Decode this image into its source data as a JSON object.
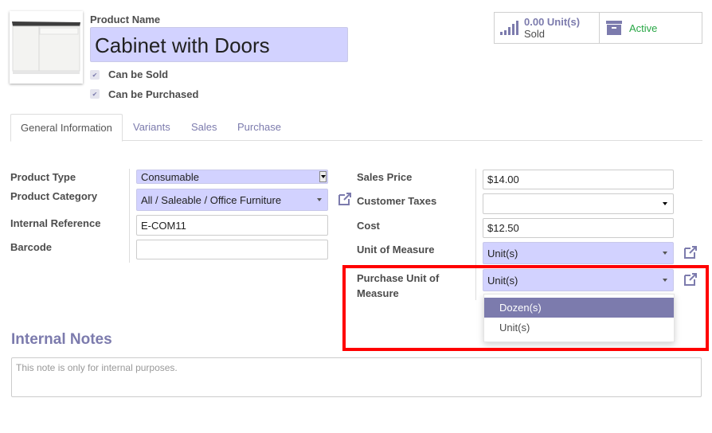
{
  "product": {
    "name_label": "Product Name",
    "name": "Cabinet with Doors",
    "can_be_sold_label": "Can be Sold",
    "can_be_sold": true,
    "can_be_purchased_label": "Can be Purchased",
    "can_be_purchased": true
  },
  "stat_buttons": {
    "sold_value": "0.00 Unit(s)",
    "sold_label": "Sold",
    "active_label": "Active",
    "active_color": "#28a745"
  },
  "tabs": [
    {
      "label": "General Information",
      "active": true
    },
    {
      "label": "Variants",
      "active": false
    },
    {
      "label": "Sales",
      "active": false
    },
    {
      "label": "Purchase",
      "active": false
    }
  ],
  "left_fields": {
    "product_type": {
      "label": "Product Type",
      "value": "Consumable"
    },
    "product_category": {
      "label": "Product Category",
      "value": "All / Saleable / Office Furniture"
    },
    "internal_reference": {
      "label": "Internal Reference",
      "value": "E-COM11"
    },
    "barcode": {
      "label": "Barcode",
      "value": ""
    }
  },
  "right_fields": {
    "sales_price": {
      "label": "Sales Price",
      "value": "$14.00"
    },
    "customer_taxes": {
      "label": "Customer Taxes",
      "value": ""
    },
    "cost": {
      "label": "Cost",
      "value": "$12.50"
    },
    "uom": {
      "label": "Unit of Measure",
      "value": "Unit(s)"
    },
    "purchase_uom": {
      "label_line1": "Purchase Unit of",
      "label_line2": "Measure",
      "value": "Unit(s)"
    }
  },
  "purchase_uom_dropdown": {
    "options": [
      "Dozen(s)",
      "Unit(s)"
    ],
    "highlighted": "Dozen(s)"
  },
  "notes": {
    "title": "Internal Notes",
    "placeholder": "This note is only for internal purposes."
  },
  "colors": {
    "accent": "#7c7bad",
    "required_field": "#d2d2ff",
    "highlight_box": "#ff0000"
  }
}
